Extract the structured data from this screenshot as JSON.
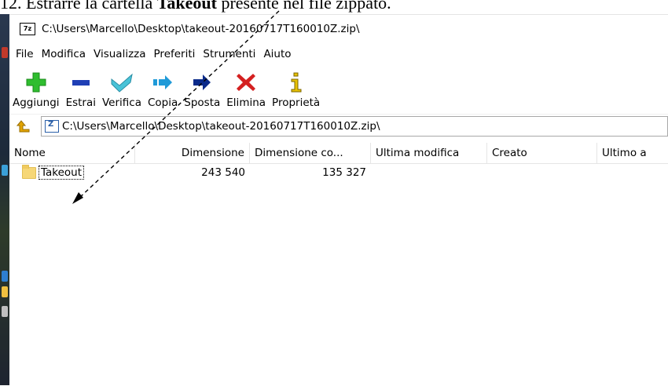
{
  "document": {
    "text_prefix": "12.  Estrarre la cartella ",
    "text_bold": "Takeout",
    "text_suffix": " presente nel file zippato."
  },
  "window": {
    "title": "C:\\Users\\Marcello\\Desktop\\takeout-20160717T160010Z.zip\\",
    "app_icon_text": "7z"
  },
  "menu": [
    "File",
    "Modifica",
    "Visualizza",
    "Preferiti",
    "Strumenti",
    "Aiuto"
  ],
  "toolbar": {
    "add": "Aggiungi",
    "extract": "Estrai",
    "verify": "Verifica",
    "copy": "Copia",
    "move": "Sposta",
    "delete": "Elimina",
    "properties": "Proprietà"
  },
  "address": {
    "path": "C:\\Users\\Marcello\\Desktop\\takeout-20160717T160010Z.zip\\"
  },
  "columns": [
    "Nome",
    "Dimensione",
    "Dimensione co...",
    "Ultima modifica",
    "Creato",
    "Ultimo a"
  ],
  "files": [
    {
      "name": "Takeout",
      "size": "243 540",
      "packed": "135 327",
      "modified": "",
      "created": "",
      "accessed": ""
    }
  ],
  "colors": {
    "add_icon": "#2fbd2f",
    "extract_icon": "#1f3fb5",
    "verify_icon": "#49c3d8",
    "copy_icon": "#1f9ad8",
    "move_icon": "#0a2a8a",
    "delete_icon": "#d42020",
    "folder": "#f6d777"
  }
}
